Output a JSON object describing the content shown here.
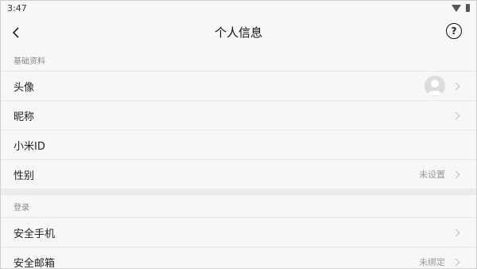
{
  "status_bar": {
    "time": "3:47",
    "icons": [
      "wifi-icon",
      "battery-icon"
    ]
  },
  "header": {
    "title": "个人信息",
    "back_icon": "chevron-left-icon",
    "help_label": "?"
  },
  "sections": [
    {
      "title": "基础资料",
      "rows": [
        {
          "label": "头像",
          "value": "",
          "icon": "avatar"
        },
        {
          "label": "昵称",
          "value": ""
        },
        {
          "label": "小米ID",
          "value": ""
        },
        {
          "label": "性别",
          "value": "未设置"
        }
      ]
    },
    {
      "title": "登录",
      "rows": [
        {
          "label": "安全手机",
          "value": ""
        },
        {
          "label": "安全邮箱",
          "value": "未绑定"
        }
      ]
    }
  ]
}
